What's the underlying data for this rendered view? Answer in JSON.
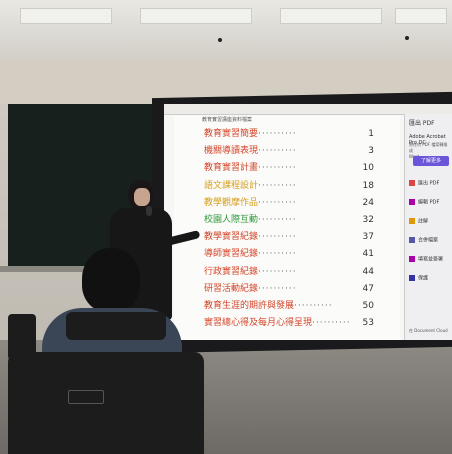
{
  "photo": {
    "scene": "presentation-in-classroom"
  },
  "slide": {
    "header_text": "教育實習講座資料檔案",
    "toc": [
      {
        "title": "教育實習簡要",
        "page": "1",
        "color": "#d4452a"
      },
      {
        "title": "機關導讀表現",
        "page": "3",
        "color": "#d4452a"
      },
      {
        "title": "教育實習計畫",
        "page": "10",
        "color": "#d4452a"
      },
      {
        "title": "語文課程設計",
        "page": "18",
        "color": "#d6a020"
      },
      {
        "title": "教學觀摩作品",
        "page": "24",
        "color": "#d6a020"
      },
      {
        "title": "校園人際互動",
        "page": "32",
        "color": "#2e9a3a"
      },
      {
        "title": "教學實習紀錄",
        "page": "37",
        "color": "#d4452a"
      },
      {
        "title": "導師實習紀錄",
        "page": "41",
        "color": "#d4452a"
      },
      {
        "title": "行政實習紀錄",
        "page": "44",
        "color": "#d4452a"
      },
      {
        "title": "研習活動紀錄",
        "page": "47",
        "color": "#d4452a"
      },
      {
        "title": "教育生涯的期許與發展",
        "page": "50",
        "color": "#d4452a"
      },
      {
        "title": "實習總心得及每月心得呈現",
        "page": "53",
        "color": "#d4452a"
      }
    ]
  },
  "sidebar": {
    "title": "匯出 PDF",
    "promo": "Adobe Acrobat Pro DC",
    "promo_sub": "將任何 PDF 檔案轉換成\nWord",
    "button": "了解更多",
    "items": [
      {
        "label": "匯出 PDF",
        "icon": "export-icon",
        "color": "#d44"
      },
      {
        "label": "編輯 PDF",
        "icon": "edit-icon",
        "color": "#a0a"
      },
      {
        "label": "註解",
        "icon": "comment-icon",
        "color": "#d90"
      },
      {
        "label": "合併檔案",
        "icon": "combine-icon",
        "color": "#55a"
      },
      {
        "label": "填寫並簽署",
        "icon": "sign-icon",
        "color": "#a0a"
      },
      {
        "label": "保護",
        "icon": "protect-icon",
        "color": "#33a"
      }
    ],
    "footer": "在 Document Cloud"
  }
}
